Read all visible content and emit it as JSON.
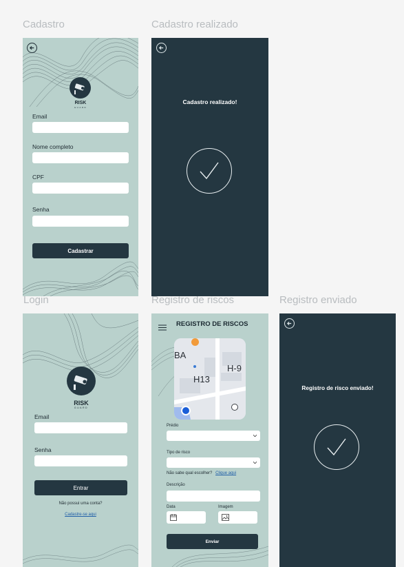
{
  "frames": {
    "cadastro": "Cadastro",
    "cadastro_realizado": "Cadastro realizado",
    "login": "Login",
    "registro_riscos": "Registro de riscos",
    "registro_enviado": "Registro enviado"
  },
  "brand": {
    "name": "RISK",
    "sub": "GUARD"
  },
  "signup": {
    "email_label": "Email",
    "name_label": "Nome completo",
    "cpf_label": "CPF",
    "password_label": "Senha",
    "submit": "Cadastrar"
  },
  "signup_done": {
    "message": "Cadastro realizado!"
  },
  "login": {
    "email_label": "Email",
    "password_label": "Senha",
    "submit": "Entrar",
    "no_account": "Não possui uma conta?",
    "register_link": "Cadastre-se aqui"
  },
  "risk_form": {
    "title": "REGISTRO DE RISCOS",
    "map_labels": {
      "a": "BA",
      "b": "H-9",
      "c": "H13"
    },
    "building_label": "Prédio",
    "risk_type_label": "Tipo de risco",
    "help_text": "Não sabe qual escolher?",
    "help_link": "Clique aqui",
    "description_label": "Descrição",
    "date_label": "Data",
    "image_label": "Imagem",
    "submit": "Enviar"
  },
  "risk_done": {
    "message": "Registro de risco enviado!"
  },
  "colors": {
    "light_bg": "#b9d1cc",
    "dark_bg": "#243741",
    "link": "#1f5ea8"
  },
  "icons": [
    "back-arrow-icon",
    "menu-icon",
    "checkmark-icon",
    "calendar-icon",
    "image-icon",
    "chevron-down-icon",
    "security-camera-icon",
    "location-pin-icon",
    "food-pin-icon"
  ]
}
